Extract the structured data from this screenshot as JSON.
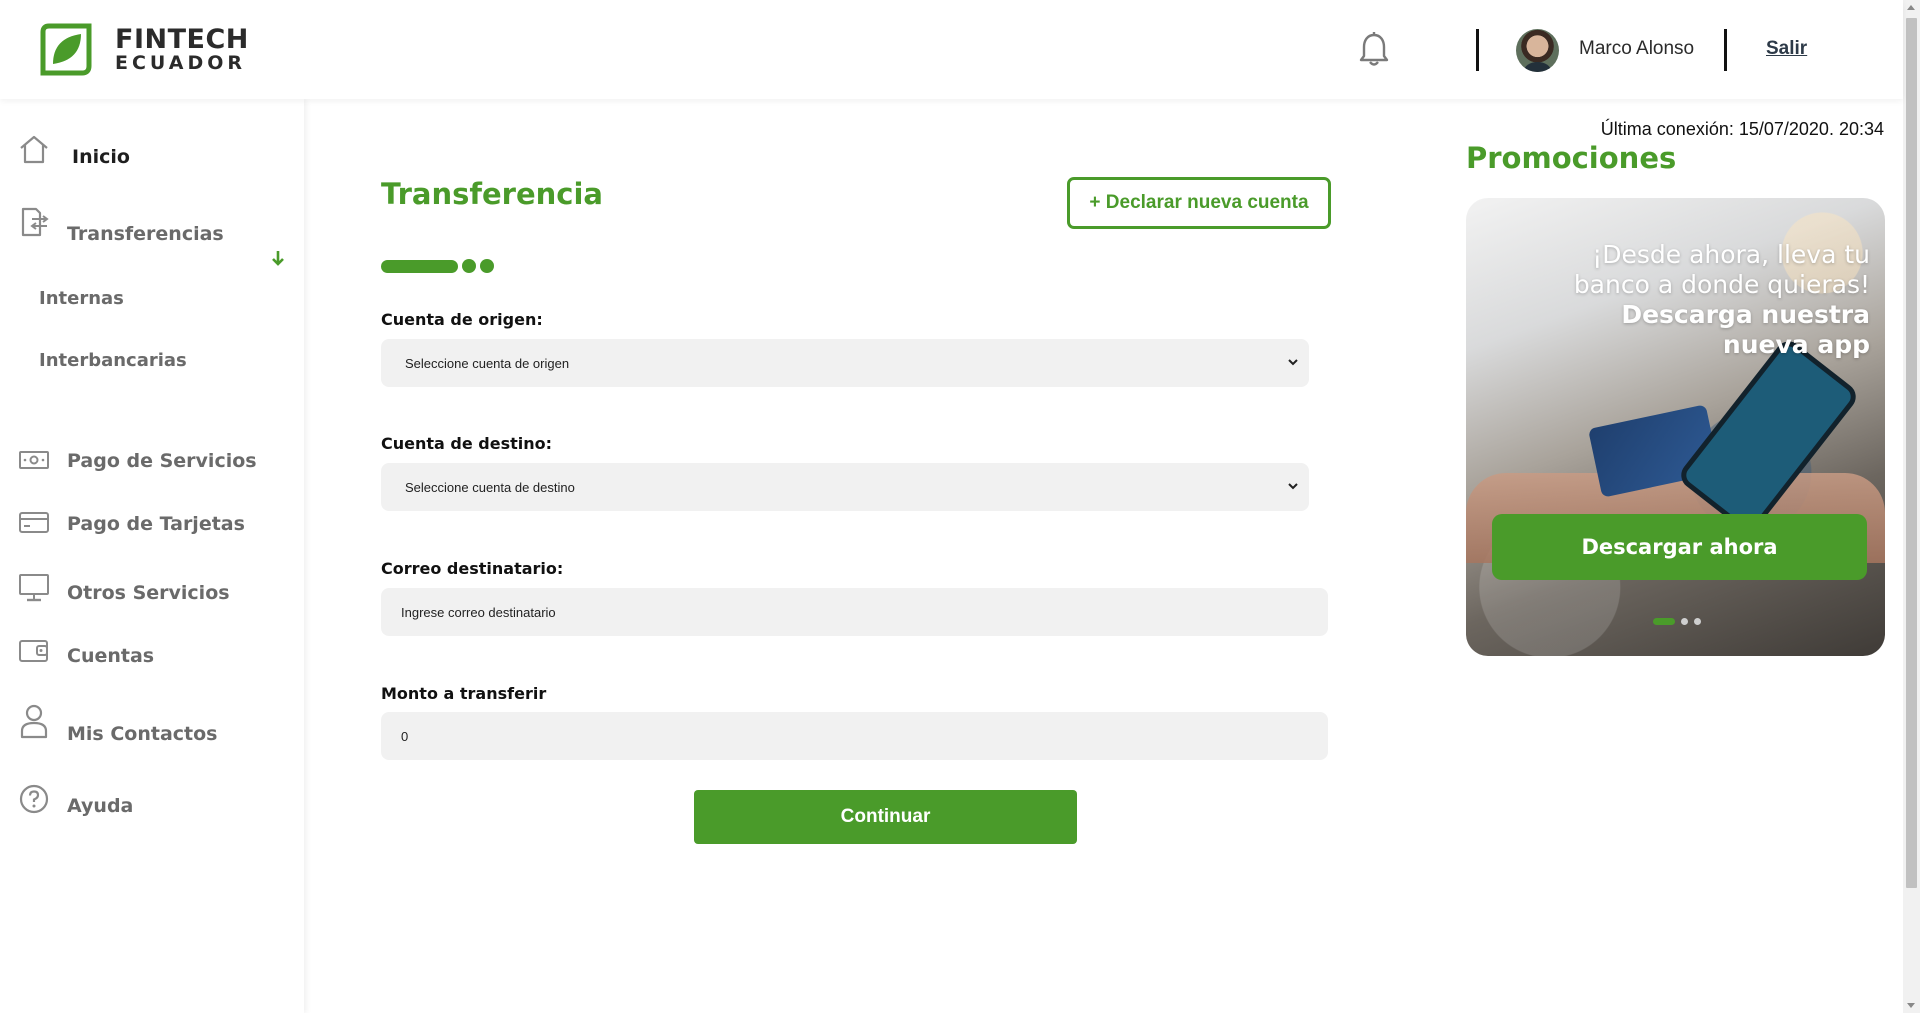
{
  "header": {
    "logo_line1": "FINTECH",
    "logo_line2": "ECUADOR",
    "notifications_icon": "bell-icon",
    "user_name": "Marco Alonso",
    "logout_label": "Salir"
  },
  "sidebar": {
    "items": [
      {
        "label": "Inicio",
        "icon": "home-icon"
      },
      {
        "label": "Transferencias",
        "icon": "transfer-icon"
      },
      {
        "label": "Pago de Servicios",
        "icon": "banknote-icon"
      },
      {
        "label": "Pago de Tarjetas",
        "icon": "credit-card-icon"
      },
      {
        "label": "Otros Servicios",
        "icon": "monitor-icon"
      },
      {
        "label": "Cuentas",
        "icon": "wallet-icon"
      },
      {
        "label": "Mis Contactos",
        "icon": "user-icon"
      },
      {
        "label": "Ayuda",
        "icon": "help-icon"
      }
    ],
    "sub_items": [
      "Internas",
      "Interbancarias"
    ],
    "expanded_icon": "arrow-down-icon"
  },
  "main": {
    "title": "Transferencia",
    "declare_button": "+ Declarar nueva cuenta",
    "steps": {
      "current": 1,
      "total": 3
    },
    "origin_label": "Cuenta de origen:",
    "origin_select": "Seleccione cuenta de origen",
    "destination_label": "Cuenta de destino:",
    "destination_select": "Seleccione cuenta de destino",
    "email_label": "Correo destinatario:",
    "email_placeholder": "Ingrese correo destinatario",
    "amount_label": "Monto a transferir",
    "amount_value": "0",
    "continue_button": "Continuar"
  },
  "right": {
    "last_connection": "Última conexión: 15/07/2020. 20:34",
    "promo_title": "Promociones",
    "promo_line1": "¡Desde ahora, lleva tu",
    "promo_line2": "banco a donde quieras!",
    "promo_line3": "Descarga nuestra",
    "promo_line4": "nueva app",
    "promo_button": "Descargar ahora",
    "carousel": {
      "current": 1,
      "total": 3
    }
  },
  "colors": {
    "brand_green": "#4a9b2a",
    "field_bg": "#f1f1f1",
    "text_dark": "#111111",
    "nav_grey": "#6a6a6a"
  }
}
